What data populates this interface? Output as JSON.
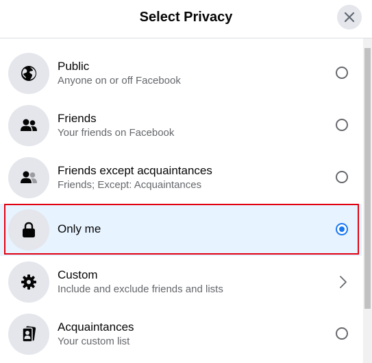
{
  "dialog": {
    "title": "Select Privacy",
    "close_icon": "close-icon"
  },
  "options": [
    {
      "title": "Public",
      "description": "Anyone on or off Facebook",
      "icon": "globe-icon",
      "control": "radio",
      "selected": false
    },
    {
      "title": "Friends",
      "description": "Your friends on Facebook",
      "icon": "friends-icon",
      "control": "radio",
      "selected": false
    },
    {
      "title": "Friends except acquaintances",
      "description": "Friends; Except: Acquaintances",
      "icon": "friends-except-icon",
      "control": "radio",
      "selected": false
    },
    {
      "title": "Only me",
      "description": "",
      "icon": "lock-icon",
      "control": "radio",
      "selected": true
    },
    {
      "title": "Custom",
      "description": "Include and exclude friends and lists",
      "icon": "gear-icon",
      "control": "chevron",
      "selected": false
    },
    {
      "title": "Acquaintances",
      "description": "Your custom list",
      "icon": "acquaintances-list-icon",
      "control": "radio",
      "selected": false
    }
  ],
  "colors": {
    "selected_background": "#e7f3ff",
    "accent": "#1877f2",
    "highlight_border": "#e0000f"
  }
}
